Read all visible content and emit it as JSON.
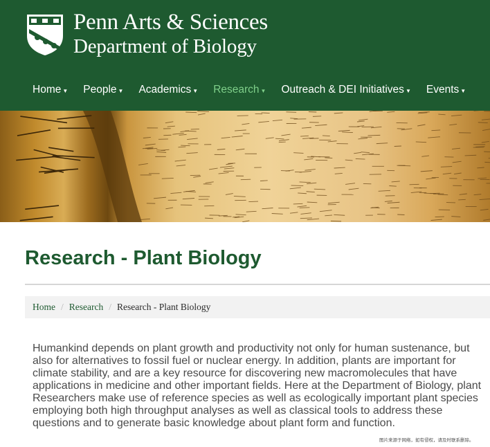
{
  "brand": {
    "line1": "Penn Arts & Sciences",
    "line2": "Department of Biology",
    "logo_icon": "shield-crest-icon"
  },
  "nav": {
    "items": [
      {
        "label": "Home",
        "active": false
      },
      {
        "label": "People",
        "active": false
      },
      {
        "label": "Academics",
        "active": false
      },
      {
        "label": "Research",
        "active": true
      },
      {
        "label": "Outreach & DEI Initiatives",
        "active": false
      },
      {
        "label": "Events",
        "active": false
      }
    ],
    "caret_icon": "caret-down-icon"
  },
  "page": {
    "title": "Research - Plant Biology"
  },
  "breadcrumb": {
    "items": [
      "Home",
      "Research",
      "Research - Plant Biology"
    ],
    "separator": "/"
  },
  "content": {
    "paragraph": "Humankind depends on plant growth and productivity not only for human sustenance, but also for alternatives to fossil fuel or nuclear energy. In addition, plants are important for climate stability, and are a key resource for discovering new macromolecules that have applications in medicine and other important fields. Here at the Department of Biology, plant Researchers make use of reference species as well as ecologically important plant species employing both high throughput analyses as well as classical tools to address these questions and to generate basic knowledge about plant form and function."
  },
  "watermark": {
    "text": "图片来源于网络，如有侵权，请及时联系删除。"
  },
  "colors": {
    "header_green": "#1e5a30",
    "active_nav": "#7fcf8a",
    "title_green": "#1e5a30",
    "breadcrumb_bg": "#f2f2f2"
  }
}
